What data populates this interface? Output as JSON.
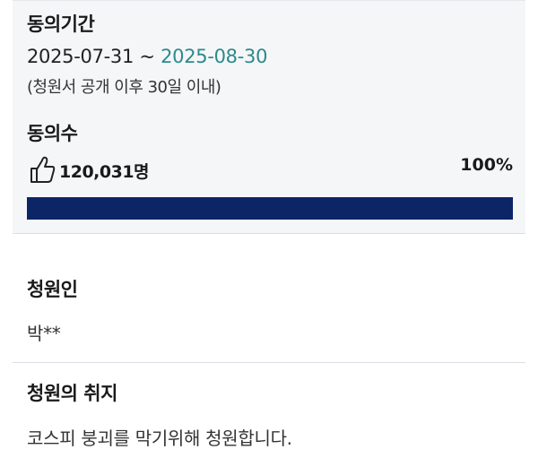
{
  "period": {
    "title": "동의기간",
    "start": "2025-07-31",
    "separator": " ~ ",
    "end": "2025-08-30",
    "note": "(청원서 공개 이후 30일 이내)"
  },
  "agreement": {
    "title": "동의수",
    "icon": "thumbs-up-icon",
    "count": "120,031명",
    "percent_label": "100%",
    "progress_fraction": 1.0,
    "bar_color": "#0c2566"
  },
  "petitioner": {
    "title": "청원인",
    "name": "박**"
  },
  "purpose": {
    "title": "청원의 취지",
    "text": "코스피 붕괴를 막기위해 청원합니다."
  },
  "colors": {
    "accent_date": "#2c8a8a",
    "panel_bg": "#f5f6f8"
  }
}
